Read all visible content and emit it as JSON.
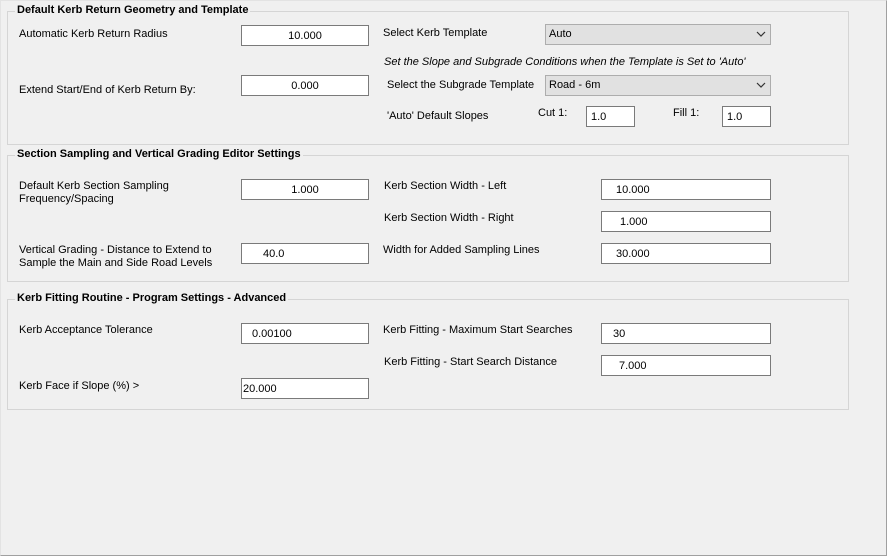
{
  "geometry": {
    "title": "Default Kerb Return Geometry and Template",
    "auto_radius_label": "Automatic Kerb Return Radius",
    "auto_radius_value": "10.000",
    "extend_label": "Extend Start/End of Kerb Return By:",
    "extend_value": "0.000",
    "template_label": "Select Kerb Template",
    "template_value": "Auto",
    "note": "Set the Slope and Subgrade Conditions when the Template is Set to 'Auto'",
    "subgrade_label": "Select the Subgrade Template",
    "subgrade_value": "Road - 6m",
    "slopes_label": "'Auto' Default Slopes",
    "cut_label": "Cut 1:",
    "cut_value": "1.0",
    "fill_label": "Fill 1:",
    "fill_value": "1.0"
  },
  "sampling": {
    "title": "Section Sampling and Vertical Grading Editor Settings",
    "freq_label": "Default Kerb Section Sampling Frequency/Spacing",
    "freq_value": "1.000",
    "vg_label": "Vertical Grading - Distance to Extend to Sample the Main and Side Road Levels",
    "vg_value": "40.0",
    "width_left_label": "Kerb Section Width - Left",
    "width_left_value": "10.000",
    "width_right_label": "Kerb Section Width - Right",
    "width_right_value": "1.000",
    "added_lines_label": "Width for Added Sampling Lines",
    "added_lines_value": "30.000"
  },
  "fitting": {
    "title": "Kerb Fitting Routine - Program Settings - Advanced",
    "tolerance_label": "Kerb Acceptance Tolerance",
    "tolerance_value": "0.00100",
    "face_label": "Kerb Face if Slope (%) >",
    "face_value": "20.000",
    "max_searches_label": "Kerb Fitting - Maximum Start Searches",
    "max_searches_value": "30",
    "search_dist_label": "Kerb Fitting - Start Search Distance",
    "search_dist_value": "7.000"
  },
  "icons": {
    "combo_arrow": "chevron-down-icon"
  }
}
